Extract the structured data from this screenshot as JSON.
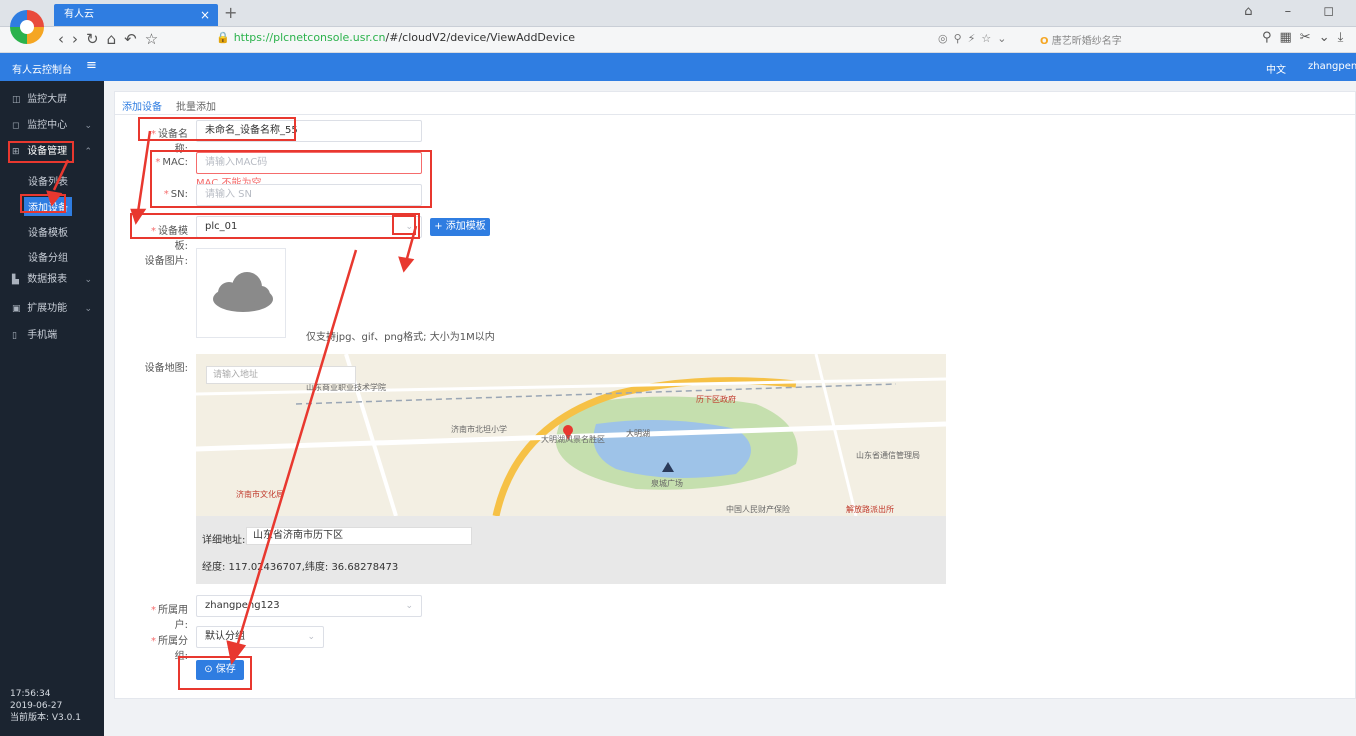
{
  "browser": {
    "tab_title": "有人云",
    "tab_close": "×",
    "tab_new": "+",
    "url_host": "https://plcnetconsole.usr.cn",
    "url_path": "/#/cloudV2/device/ViewAddDevice",
    "search_hint": "唐艺昕婚纱名字",
    "window_controls": "⌂ – ◻"
  },
  "header": {
    "app_title": "有人云控制台",
    "menu_toggle": "≡",
    "language": "中文",
    "username": "zhangpen"
  },
  "sidebar": {
    "items": [
      {
        "label": "监控大屏",
        "icon": "monitor-screen-icon",
        "glyph": "◫"
      },
      {
        "label": "监控中心",
        "icon": "monitor-center-icon",
        "glyph": "◻",
        "chevron": "⌄"
      },
      {
        "label": "设备管理",
        "icon": "device-manage-icon",
        "glyph": "⊞",
        "chevron": "⌃"
      },
      {
        "label": "数据报表",
        "icon": "data-report-icon",
        "glyph": "▙",
        "chevron": "⌄"
      },
      {
        "label": "扩展功能",
        "icon": "extension-icon",
        "glyph": "▣",
        "chevron": "⌄"
      },
      {
        "label": "手机端",
        "icon": "mobile-icon",
        "glyph": "▯"
      }
    ],
    "sub_items": [
      "设备列表",
      "添加设备",
      "设备模板",
      "设备分组"
    ],
    "footer_time": "17:56:34",
    "footer_date": "2019-06-27",
    "footer_version": "当前版本: V3.0.1"
  },
  "tabs": {
    "add_device": "添加设备",
    "batch_add": "批量添加"
  },
  "form": {
    "required_mark": "*",
    "device_name_label": "设备名称:",
    "device_name_value": "未命名_设备名称_55",
    "mac_label": "MAC:",
    "mac_placeholder": "请输入MAC码",
    "mac_error": "MAC 不能为空",
    "sn_label": "SN:",
    "sn_placeholder": "请输入 SN",
    "template_label": "设备模板:",
    "template_value": "plc_01",
    "add_template_button": "+ 添加模板",
    "image_label": "设备图片:",
    "image_hint": "仅支持jpg、gif、png格式; 大小为1M以内",
    "map_label": "设备地图:",
    "map_search_placeholder": "请输入地址",
    "address_label": "详细地址:",
    "address_value": "山东省济南市历下区",
    "coords_text": "经度: 117.02436707,纬度: 36.68278473",
    "owner_label": "所属用户:",
    "owner_value": "zhangpeng123",
    "group_label": "所属分组:",
    "group_value": "默认分组",
    "save_button": "⊙ 保存"
  },
  "map_labels": [
    "山东商业职业技术学院",
    "大明湖",
    "济南市北坦小学",
    "大明湖风景名胜区",
    "泉城广场",
    "历下区政府",
    "济南市文化局",
    "中国人民财产保险",
    "解放路派出所",
    "山东省通信管理局"
  ],
  "colors": {
    "primary": "#2f7de1",
    "sidebar": "#1b2430",
    "error": "#f56c6c",
    "annotation": "#e8382f",
    "lake": "#9ec3e8",
    "park": "#c5dfae"
  }
}
